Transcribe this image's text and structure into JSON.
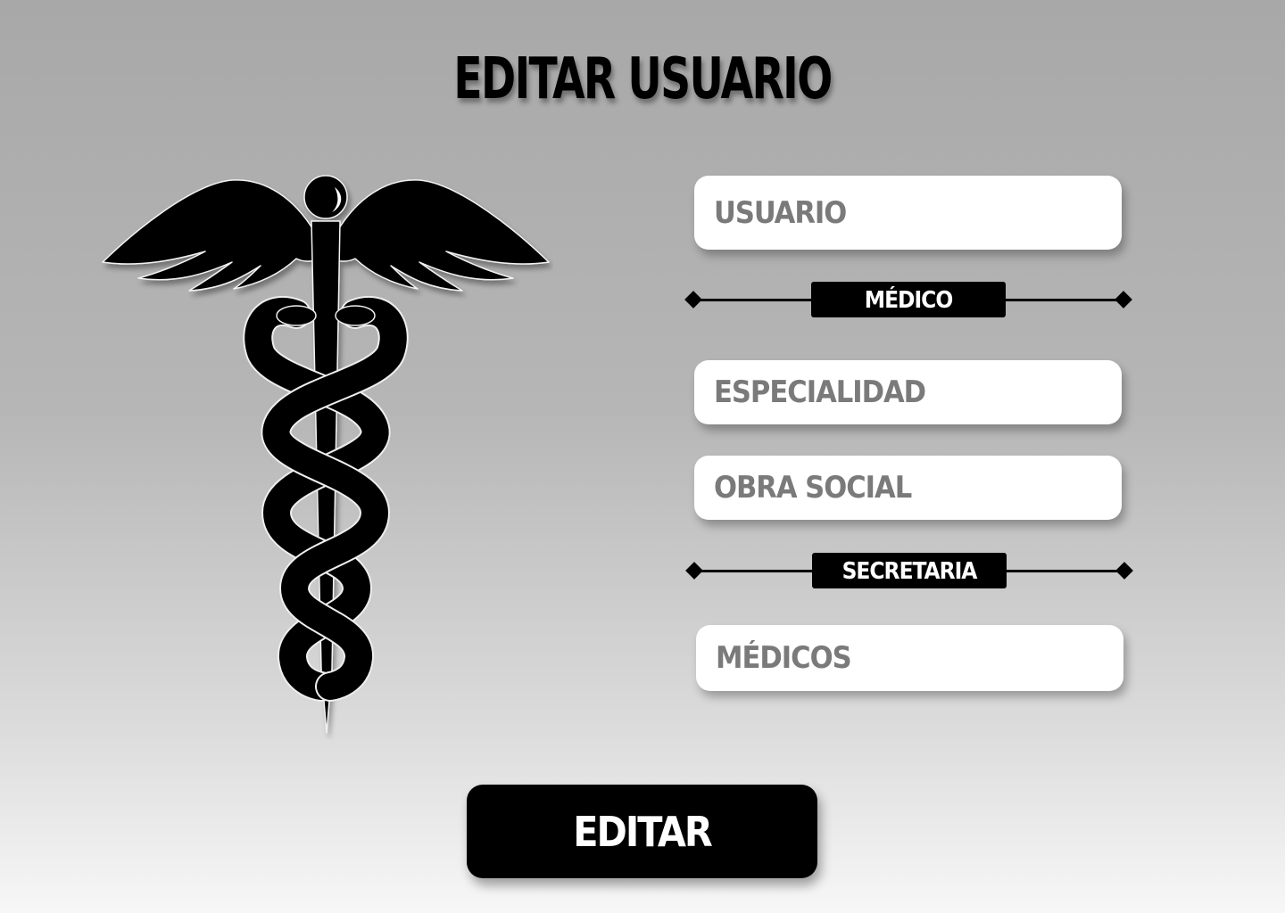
{
  "page": {
    "title": "EDITAR USUARIO"
  },
  "emblem": {
    "icon": "caduceus-icon"
  },
  "form": {
    "usuario": {
      "placeholder": "USUARIO",
      "value": ""
    },
    "medico_section": {
      "label": "MÉDICO"
    },
    "especialidad": {
      "placeholder": "ESPECIALIDAD",
      "value": ""
    },
    "obra_social": {
      "placeholder": "OBRA SOCIAL",
      "value": ""
    },
    "secretaria_section": {
      "label": "SECRETARIA"
    },
    "medicos": {
      "placeholder": "MÉDICOS",
      "value": ""
    },
    "submit_label": "EDITAR"
  },
  "colors": {
    "accent": "#000000",
    "field_bg": "#ffffff",
    "placeholder_text": "#7a7a7a",
    "background_top": "#a8a8a8",
    "background_bottom": "#f7f7f7"
  }
}
